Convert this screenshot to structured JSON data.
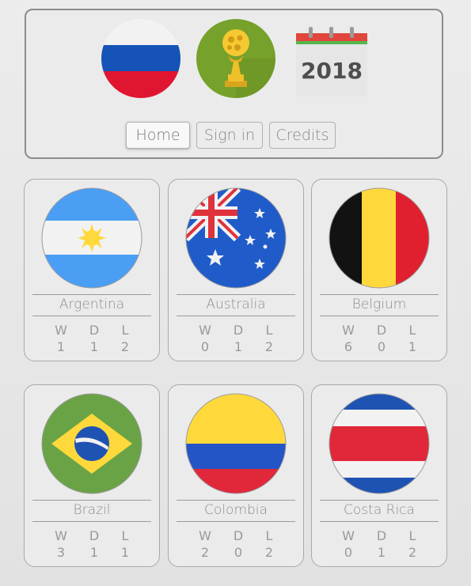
{
  "header": {
    "icons": [
      "russia-flag-icon",
      "world-cup-trophy-icon",
      "calendar-icon"
    ],
    "calendar_year": "2018",
    "nav": [
      {
        "label": "Home",
        "active": true
      },
      {
        "label": "Sign in",
        "active": false
      },
      {
        "label": "Credits",
        "active": false
      }
    ]
  },
  "stat_headers": {
    "w": "W",
    "d": "D",
    "l": "L"
  },
  "teams": [
    {
      "name": "Argentina",
      "flag": "argentina-flag-icon",
      "w": "1",
      "d": "1",
      "l": "2"
    },
    {
      "name": "Australia",
      "flag": "australia-flag-icon",
      "w": "0",
      "d": "1",
      "l": "2"
    },
    {
      "name": "Belgium",
      "flag": "belgium-flag-icon",
      "w": "6",
      "d": "0",
      "l": "1"
    },
    {
      "name": "Brazil",
      "flag": "brazil-flag-icon",
      "w": "3",
      "d": "1",
      "l": "1"
    },
    {
      "name": "Colombia",
      "flag": "colombia-flag-icon",
      "w": "2",
      "d": "0",
      "l": "2"
    },
    {
      "name": "Costa Rica",
      "flag": "costa-rica-flag-icon",
      "w": "0",
      "d": "1",
      "l": "2"
    }
  ],
  "colors": {
    "argentina_blue": "#4a9ff5",
    "argentina_sun": "#ffd93b",
    "australia_blue": "#1f5cc9",
    "australia_red": "#e0323c",
    "belgium_black": "#121212",
    "belgium_yellow": "#ffd93b",
    "belgium_red": "#e0202e",
    "brazil_green": "#6aa345",
    "brazil_yellow": "#ffd93b",
    "brazil_blue": "#1f53b3",
    "colombia_yellow": "#ffd93b",
    "colombia_blue": "#2455c6",
    "colombia_red": "#e0283a",
    "costa_rica_blue": "#1f53b3",
    "costa_rica_red": "#e0283a",
    "russia_blue": "#1553b6",
    "russia_red": "#e0152f",
    "trophy_green": "#76a12a",
    "trophy_gold": "#f0c02a",
    "calendar_red": "#e0463c",
    "calendar_green": "#54b84e"
  }
}
